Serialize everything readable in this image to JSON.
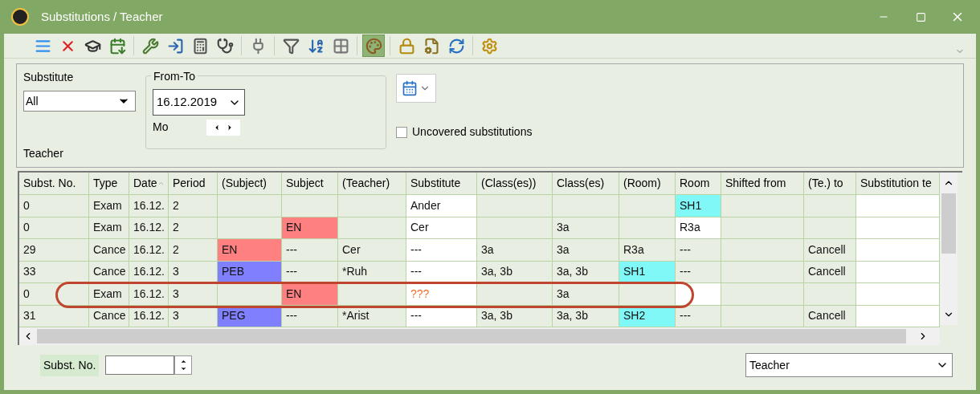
{
  "window": {
    "title": "Substitutions / Teacher"
  },
  "toolbar": [
    {
      "selected": false
    },
    {
      "selected": false
    },
    {
      "selected": false
    },
    {
      "selected": false
    },
    {
      "selected": false
    },
    {
      "selected": false
    },
    {
      "selected": false
    },
    {
      "selected": false
    },
    {
      "selected": false
    },
    {
      "selected": false
    },
    {
      "selected": false
    },
    {
      "selected": false
    },
    {
      "selected": true
    },
    {
      "selected": false
    },
    {
      "selected": false
    },
    {
      "selected": false
    },
    {
      "selected": false
    }
  ],
  "filter": {
    "substitute_label": "Substitute",
    "substitute_value": "All",
    "range_label": "From-To",
    "date_value": "16.12.2019",
    "weekday": "Mo",
    "uncovered": {
      "label": "Uncovered substitutions",
      "checked": false
    },
    "view_label": "Teacher"
  },
  "table": {
    "columns": [
      "Subst. No.",
      "Type",
      "Date",
      "Period",
      "(Subject)",
      "Subject",
      "(Teacher)",
      "Substitute",
      "(Class(es))",
      "Class(es)",
      "(Room)",
      "Room",
      "Shifted from",
      "(Te.) to",
      "Substitution te"
    ],
    "rows": [
      {
        "cells": [
          "0",
          "Exam",
          "16.12.",
          "2",
          "",
          "",
          "",
          {
            "text": "Ander",
            "color": "#ffffff"
          },
          "",
          "",
          "",
          {
            "text": "SH1",
            "color": "#80f8f8"
          },
          "",
          "",
          {
            "text": "",
            "color": "#ffffff"
          }
        ]
      },
      {
        "cells": [
          "0",
          "Exam",
          "16.12.",
          "2",
          "",
          {
            "text": "EN",
            "color": "#ff8080"
          },
          "",
          {
            "text": "Cer",
            "color": "#ffffff"
          },
          "",
          "3a",
          "",
          {
            "text": "R3a",
            "color": "#ffffff"
          },
          "",
          "",
          {
            "text": "",
            "color": "#ffffff"
          }
        ]
      },
      {
        "cells": [
          "29",
          "Cance",
          "16.12.",
          "2",
          {
            "text": "EN",
            "color": "#ff8080"
          },
          "---",
          "Cer",
          {
            "text": "---",
            "color": "#ffffff"
          },
          "3a",
          "3a",
          "R3a",
          "---",
          "",
          "Cancell",
          {
            "text": "",
            "color": "#ffffff"
          }
        ]
      },
      {
        "cells": [
          "33",
          "Cance",
          "16.12.",
          "3",
          {
            "text": "PEB",
            "color": "#8080ff"
          },
          "---",
          "*Ruh",
          {
            "text": "---",
            "color": "#ffffff"
          },
          "3a, 3b",
          "3a, 3b",
          {
            "text": "SH1",
            "color": "#80f8f8"
          },
          "---",
          "",
          "Cancell",
          {
            "text": "",
            "color": "#ffffff"
          }
        ]
      },
      {
        "cells": [
          "0",
          "Exam",
          "16.12.",
          "3",
          "",
          {
            "text": "EN",
            "color": "#ff8080"
          },
          "",
          {
            "text": "???",
            "color": "#ffffff",
            "alert": true
          },
          "",
          "3a",
          "",
          {
            "text": "",
            "color": "#ffffff"
          },
          "",
          "",
          {
            "text": "",
            "color": "#ffffff"
          }
        ]
      },
      {
        "cells": [
          "31",
          "Cance",
          "16.12.",
          "3",
          {
            "text": "PEG",
            "color": "#8080ff"
          },
          "---",
          "*Arist",
          {
            "text": "---",
            "color": "#ffffff"
          },
          "3a, 3b",
          "3a, 3b",
          {
            "text": "SH2",
            "color": "#80f8f8"
          },
          "---",
          "",
          "Cancell",
          {
            "text": "",
            "color": "#ffffff"
          }
        ]
      }
    ]
  },
  "footer": {
    "number_label": "Subst. No.",
    "view_value": "Teacher"
  }
}
